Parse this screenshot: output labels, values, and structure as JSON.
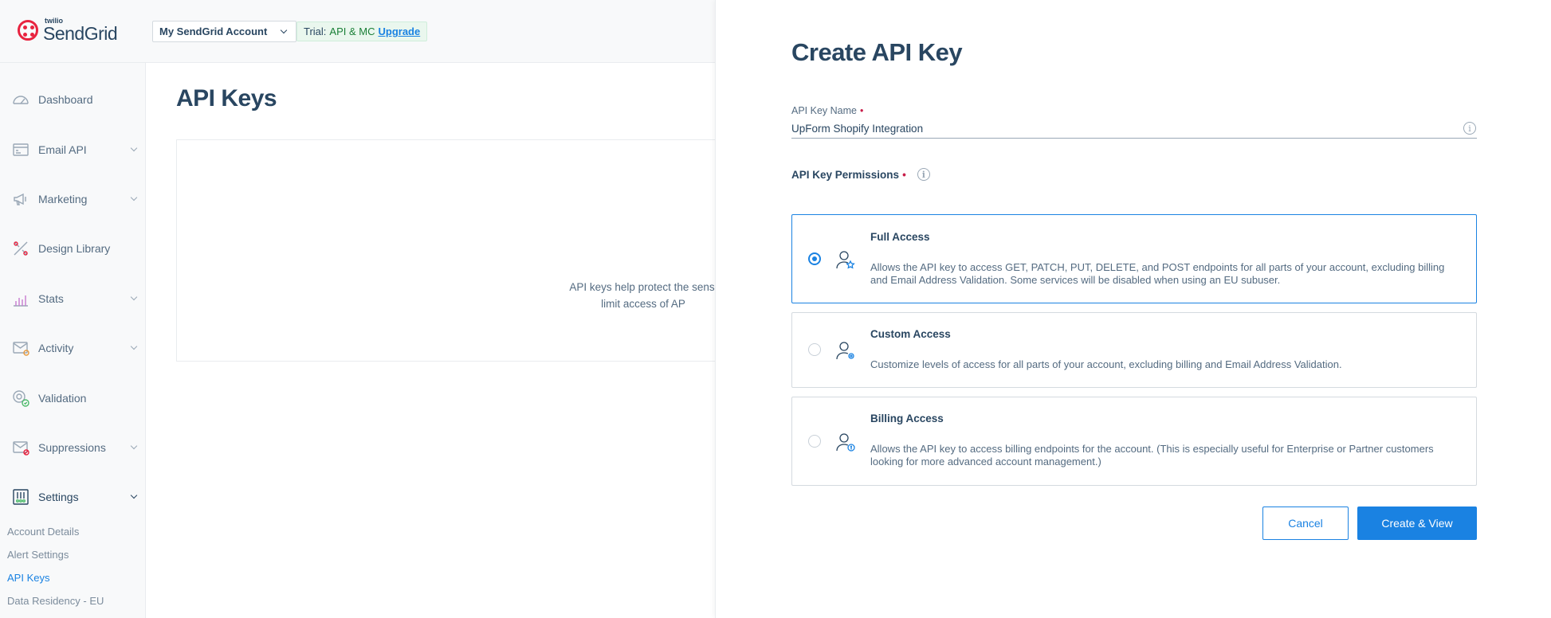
{
  "brand": {
    "small": "twilio",
    "name": "SendGrid",
    "color": "#e8233f"
  },
  "header": {
    "account_select": "My SendGrid Account",
    "trial_label": "Trial:",
    "trial_plan": "API & MC",
    "upgrade_label": "Upgrade"
  },
  "sidebar": {
    "items": [
      {
        "label": "Dashboard",
        "icon": "gauge-icon",
        "has_chevron": false
      },
      {
        "label": "Email API",
        "icon": "email-api-icon",
        "has_chevron": true
      },
      {
        "label": "Marketing",
        "icon": "megaphone-icon",
        "has_chevron": true
      },
      {
        "label": "Design Library",
        "icon": "design-library-icon",
        "has_chevron": false
      },
      {
        "label": "Stats",
        "icon": "stats-icon",
        "has_chevron": true
      },
      {
        "label": "Activity",
        "icon": "activity-icon",
        "has_chevron": true
      },
      {
        "label": "Validation",
        "icon": "validation-icon",
        "has_chevron": false
      },
      {
        "label": "Suppressions",
        "icon": "suppressions-icon",
        "has_chevron": true
      },
      {
        "label": "Settings",
        "icon": "settings-icon",
        "has_chevron": true
      }
    ],
    "sub_items": [
      "Account Details",
      "Alert Settings",
      "API Keys",
      "Data Residency - EU"
    ],
    "active_sub_item": "API Keys"
  },
  "main": {
    "title": "API Keys",
    "empty_line1": "API keys help protect the sensi",
    "empty_line2": "limit access of AP"
  },
  "drawer": {
    "title": "Create API Key",
    "name_label": "API Key Name",
    "name_value": "UpForm Shopify Integration",
    "permissions_label": "API Key Permissions",
    "required_marker": "•",
    "options": [
      {
        "title": "Full Access",
        "desc": "Allows the API key to access GET, PATCH, PUT, DELETE, and POST endpoints for all parts of your account, excluding billing and Email Address Validation. Some services will be disabled when using an EU subuser.",
        "selected": true,
        "icon": "user-star-icon"
      },
      {
        "title": "Custom Access",
        "desc": "Customize levels of access for all parts of your account, excluding billing and Email Address Validation.",
        "selected": false,
        "icon": "user-gear-icon"
      },
      {
        "title": "Billing Access",
        "desc": "Allows the API key to access billing endpoints for the account. (This is especially useful for Enterprise or Partner customers looking for more advanced account management.)",
        "selected": false,
        "icon": "user-billing-icon"
      }
    ],
    "cancel_label": "Cancel",
    "create_label": "Create & View"
  },
  "colors": {
    "accent": "#1a82e2",
    "text": "#294661",
    "muted": "#546b81"
  }
}
